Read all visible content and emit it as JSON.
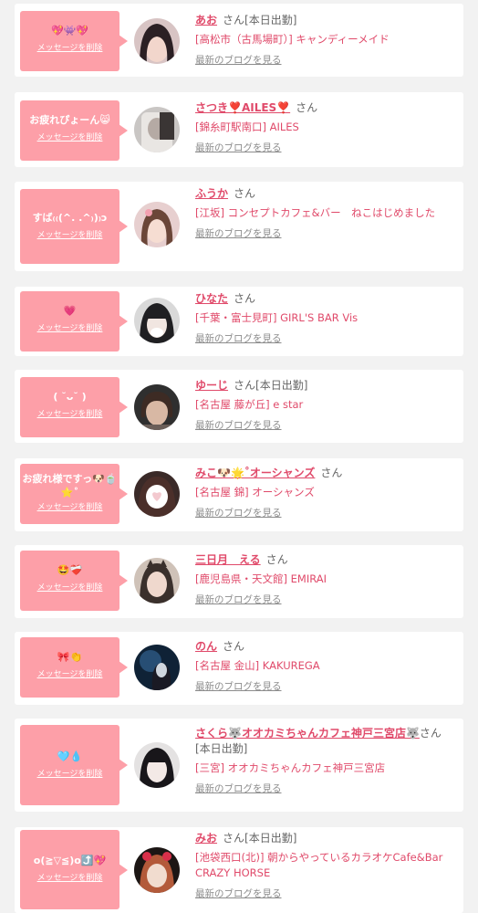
{
  "delete_label": "メッセージを削除",
  "blog_label": "最新のブログを見る",
  "san_label": "さん",
  "colors": {
    "bubble": "#fd9fa8",
    "name": "#e04a6a",
    "shop": "#e04a6a",
    "muted": "#8c8c8c"
  },
  "items": [
    {
      "message": "💖👾💖",
      "name": "あお",
      "tag": "[本日出勤]",
      "shop": "[高松市（古馬場町）] キャンディーメイド"
    },
    {
      "message": "お疲れぴょーん😸",
      "name": "さつき❣️AILES❣️",
      "tag": "",
      "shop": "[錦糸町駅南口] AILES"
    },
    {
      "message": "すば₍₍(^. .^₎)₎ɔ",
      "name": "ふうか",
      "tag": "",
      "shop": "[江坂] コンセプトカフェ&バー　ねこはじめました"
    },
    {
      "message": "💗",
      "name": "ひなた",
      "tag": "",
      "shop": "[千葉・富士見町] GIRL'S BAR Vis"
    },
    {
      "message": "( ˘ᴗ˘ )",
      "name": "ゆーじ",
      "tag": "[本日出勤]",
      "shop": "[名古屋 藤が丘] e star"
    },
    {
      "message": "お疲れ様ですっ🐶🍵⭐️˚",
      "name": "みこ🐶🌟˚オーシャンズ",
      "tag": "",
      "shop": "[名古屋 錦] オーシャンズ"
    },
    {
      "message": "🤩❤️‍🩹",
      "name": "三日月　える",
      "tag": "",
      "shop": "[鹿児島県・天文館] EMIRAI"
    },
    {
      "message": "🎀👏",
      "name": "のん",
      "tag": "",
      "shop": "[名古屋 金山] KAKUREGA"
    },
    {
      "message": "🩵💧",
      "name": "さくら🐺オオカミちゃんカフェ神戸三宮店🐺",
      "tag": "[本日出勤]",
      "shop": "[三宮] オオカミちゃんカフェ神戸三宮店"
    },
    {
      "message": "o(≧▽≦)o⤴️💖",
      "name": "みお",
      "tag": "[本日出勤]",
      "shop": "[池袋西口(北)] 朝からやっているカラオケCafe&Bar CRAZY HORSE"
    }
  ]
}
